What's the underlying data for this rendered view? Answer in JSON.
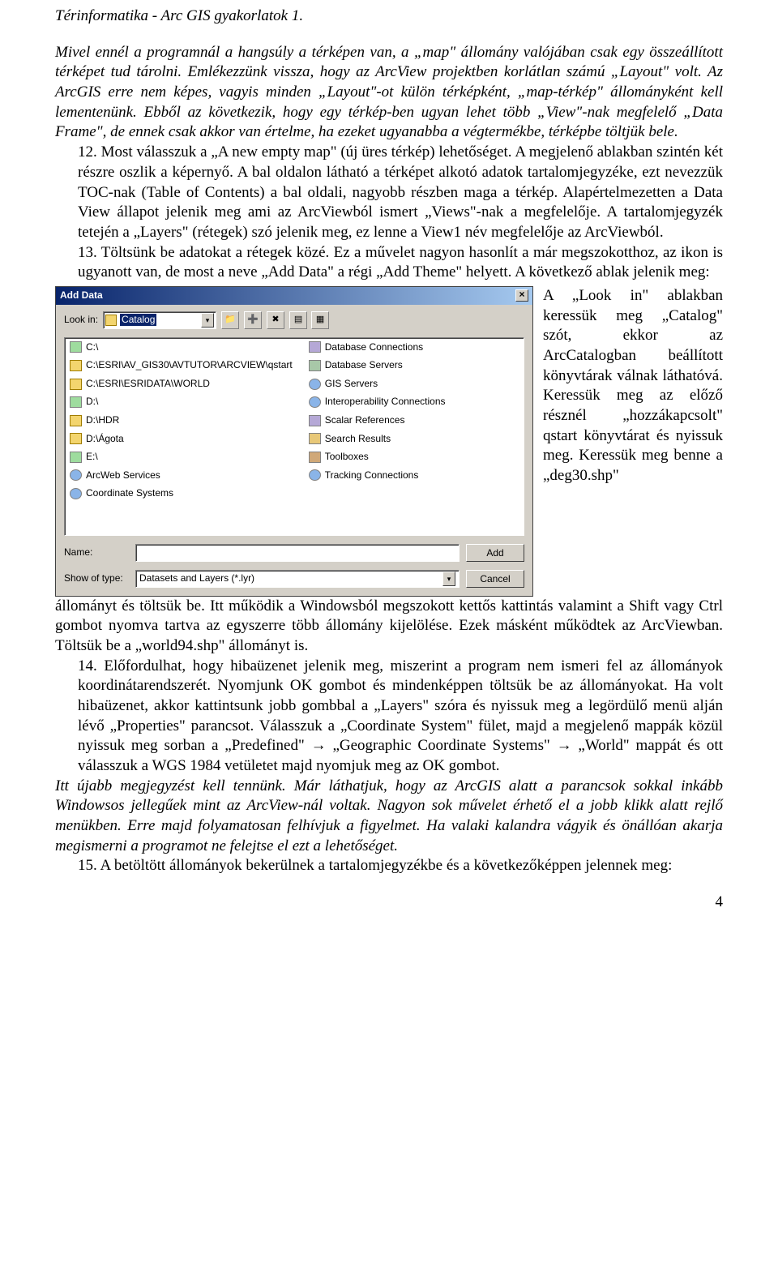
{
  "header": "Térinformatika - Arc GIS gyakorlatok 1.",
  "intro_italic": "Mivel ennél a programnál a hangsúly a térképen van, a „map\" állomány valójában csak egy összeállított térképet tud tárolni. Emlékezzünk vissza, hogy az ArcView projektben korlátlan számú „Layout\" volt. Az ArcGIS erre nem képes, vagyis minden „Layout\"-ot külön térképként, „map-térkép\" állományként kell lementenünk. Ebből az következik, hogy egy térkép-ben ugyan lehet több „View\"-nak megfelelő „Data Frame\", de ennek csak akkor van értelme, ha ezeket ugyanabba a végtermékbe, térképbe töltjük bele.",
  "item12": "12. Most válasszuk a „A new empty map\" (új üres térkép) lehetőséget. A megjelenő ablakban szintén két részre oszlik a képernyő. A bal oldalon látható a térképet alkotó adatok tartalomjegyzéke, ezt nevezzük TOC-nak (Table of Contents) a bal oldali, nagyobb részben maga a térkép. Alapértelmezetten a Data View állapot jelenik meg ami az ArcViewból ismert „Views\"-nak a megfelelője. A tartalomjegyzék tetején a „Layers\" (rétegek) szó jelenik meg, ez lenne a View1 név megfelelője az ArcViewból.",
  "item13": "13. Töltsünk be adatokat a rétegek közé. Ez a művelet nagyon hasonlít a már megszokotthoz, az ikon is ugyanott van, de most a neve „Add Data\" a régi „Add Theme\" helyett. A következő ablak jelenik meg:",
  "dialog": {
    "title": "Add Data",
    "close": "×",
    "lookin_label": "Look in:",
    "lookin_value": "Catalog",
    "items_left": [
      {
        "icon": "drive",
        "label": "C:\\"
      },
      {
        "icon": "folder",
        "label": "C:\\ESRI\\AV_GIS30\\AVTUTOR\\ARCVIEW\\qstart"
      },
      {
        "icon": "folder",
        "label": "C:\\ESRI\\ESRIDATA\\WORLD"
      },
      {
        "icon": "drive",
        "label": "D:\\"
      },
      {
        "icon": "folder",
        "label": "D:\\HDR"
      },
      {
        "icon": "folder",
        "label": "D:\\Ágota"
      },
      {
        "icon": "drive",
        "label": "E:\\"
      },
      {
        "icon": "globe",
        "label": "ArcWeb Services"
      },
      {
        "icon": "globe",
        "label": "Coordinate Systems"
      }
    ],
    "items_right": [
      {
        "icon": "db",
        "label": "Database Connections"
      },
      {
        "icon": "server",
        "label": "Database Servers"
      },
      {
        "icon": "globe",
        "label": "GIS Servers"
      },
      {
        "icon": "globe",
        "label": "Interoperability Connections"
      },
      {
        "icon": "db",
        "label": "Scalar References"
      },
      {
        "icon": "search",
        "label": "Search Results"
      },
      {
        "icon": "tool",
        "label": "Toolboxes"
      },
      {
        "icon": "globe",
        "label": "Tracking Connections"
      }
    ],
    "name_label": "Name:",
    "name_value": "",
    "type_label": "Show of type:",
    "type_value": "Datasets and Layers (*.lyr)",
    "add_btn": "Add",
    "cancel_btn": "Cancel"
  },
  "side_text": "A „Look in\" ablakban keressük meg „Catalog\" szót, ekkor az ArcCatalogban beállított könyvtárak válnak láthatóvá. Keressük meg az előző résznél „hozzákapcsolt\" qstart könyvtárat és nyissuk meg. Keressük meg benne a „deg30.shp\"",
  "after_dialog": "állományt és töltsük be. Itt működik a Windowsból megszokott kettős kattintás valamint a Shift vagy Ctrl gombot nyomva tartva az egyszerre több állomány kijelölése. Ezek másként működtek az ArcViewban. Töltsük be a „world94.shp\" állományt is.",
  "item14": "14. Előfordulhat, hogy hibaüzenet jelenik meg, miszerint a program nem ismeri fel az állományok koordinátarendszerét. Nyomjunk OK gombot és mindenképpen töltsük be az állományokat. Ha volt hibaüzenet, akkor kattintsunk jobb gombbal a „Layers\" szóra és nyissuk meg a legördülő menü alján lévő „Properties\" parancsot. Válasszuk a „Coordinate System\" fület, majd a megjelenő mappák közül nyissuk meg sorban a „Predefined\" → „Geographic Coordinate Systems\" → „World\" mappát és ott válasszuk a WGS 1984 vetületet majd nyomjuk meg az OK gombot.",
  "remark_italic": "Itt újabb megjegyzést kell tennünk. Már láthatjuk, hogy az ArcGIS alatt a parancsok sokkal inkább Windowsos jellegűek mint az ArcView-nál voltak. Nagyon sok művelet érhető el a jobb klikk alatt rejlő menükben. Erre majd folyamatosan felhívjuk a figyelmet. Ha valaki kalandra vágyik és önállóan akarja megismerni a programot ne felejtse el ezt a lehetőséget.",
  "item15": "15. A betöltött állományok bekerülnek a tartalomjegyzékbe és a következőképpen jelennek meg:",
  "page_num": "4"
}
